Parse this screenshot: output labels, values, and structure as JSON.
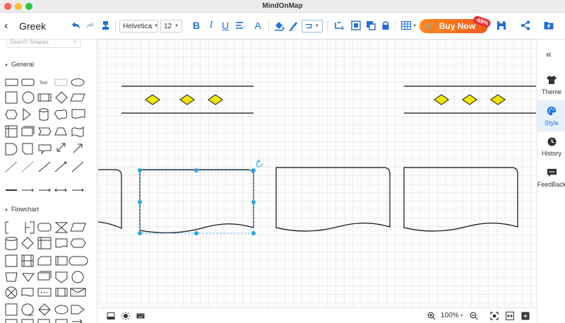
{
  "window": {
    "title": "MindOnMap"
  },
  "toolbar": {
    "doc_title": "Greek",
    "font_family": "Helvetica",
    "font_size": "12",
    "buy_label": "Buy Now",
    "discount": "-69%"
  },
  "left_panel": {
    "search_placeholder": "Search Shapes",
    "sections": [
      {
        "title": "General",
        "text_shape_label": "Text"
      },
      {
        "title": "Flowchart"
      }
    ]
  },
  "right_panel": {
    "items": [
      {
        "label": "Theme",
        "icon": "shirt-icon"
      },
      {
        "label": "Style",
        "icon": "palette-icon",
        "active": true
      },
      {
        "label": "History",
        "icon": "clock-icon"
      },
      {
        "label": "FeedBack",
        "icon": "chat-icon"
      }
    ]
  },
  "bottom_bar": {
    "zoom": "100%"
  },
  "colors": {
    "accent": "#1e6fd9",
    "diamond_fill": "#f2e600",
    "selection": "#29a6e5",
    "buy_start": "#ff8a1a",
    "buy_end": "#f55a1e"
  }
}
